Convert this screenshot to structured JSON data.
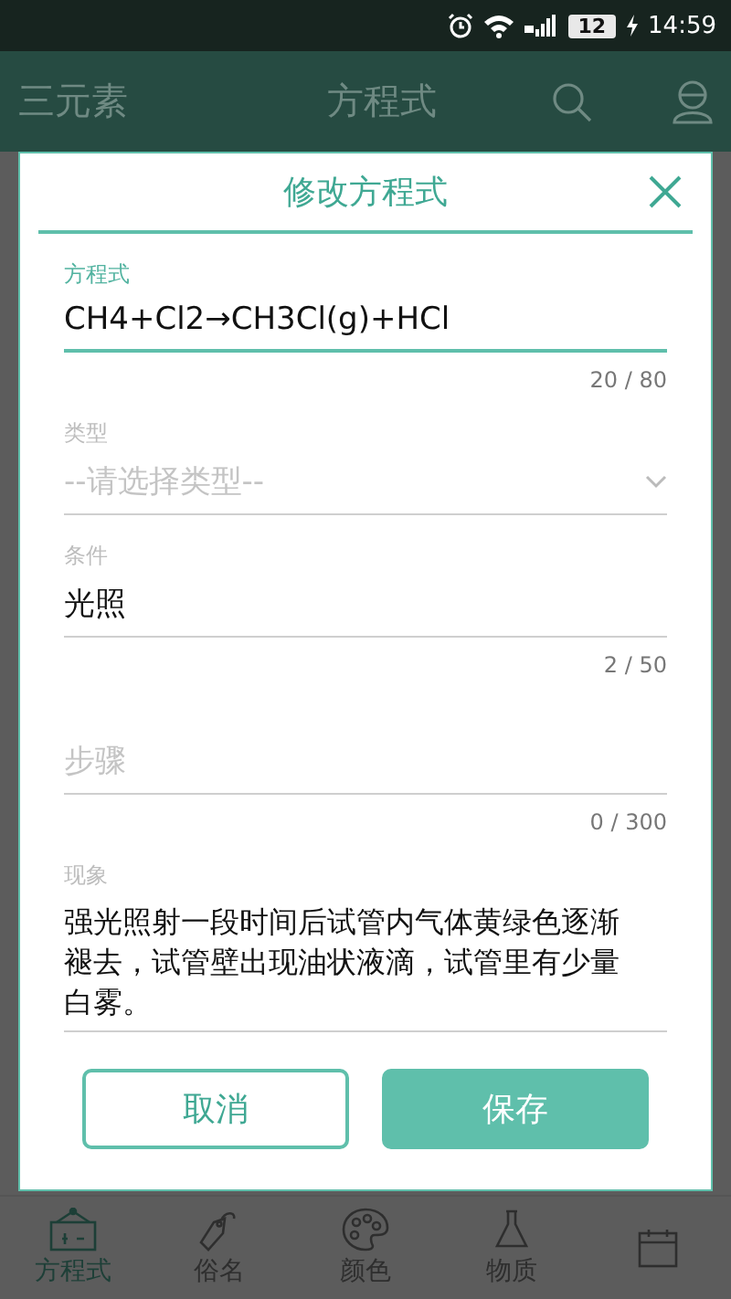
{
  "status_bar": {
    "battery": "12",
    "time": "14:59"
  },
  "app_bar": {
    "menu_label": "三元素",
    "title": "方程式"
  },
  "dialog": {
    "title": "修改方程式",
    "fields": [
      {
        "kind": "text",
        "label": "方程式",
        "value": "CH4+Cl2→CH3Cl(g)+HCl",
        "counter": "20 / 80",
        "focused": true
      },
      {
        "kind": "select",
        "label": "类型",
        "placeholder": "--请选择类型--"
      },
      {
        "kind": "text",
        "label": "条件",
        "value": "光照",
        "counter": "2 / 50",
        "focused": false
      },
      {
        "kind": "text",
        "placeholder": "步骤",
        "counter": "0 / 300",
        "focused": false
      },
      {
        "kind": "multiline",
        "label": "现象",
        "value": "强光照射一段时间后试管内气体黄绿色逐渐褪去，试管壁出现油状液滴，试管里有少量白雾。",
        "focused": false
      }
    ],
    "buttons": [
      {
        "label": "取消",
        "kind": "outline"
      },
      {
        "label": "保存",
        "kind": "filled"
      }
    ]
  },
  "bottom_nav": [
    {
      "label": "方程式",
      "selected": true
    },
    {
      "label": "俗名",
      "selected": false
    },
    {
      "label": "颜色",
      "selected": false
    },
    {
      "label": "物质",
      "selected": false
    },
    {
      "selected": false
    }
  ]
}
